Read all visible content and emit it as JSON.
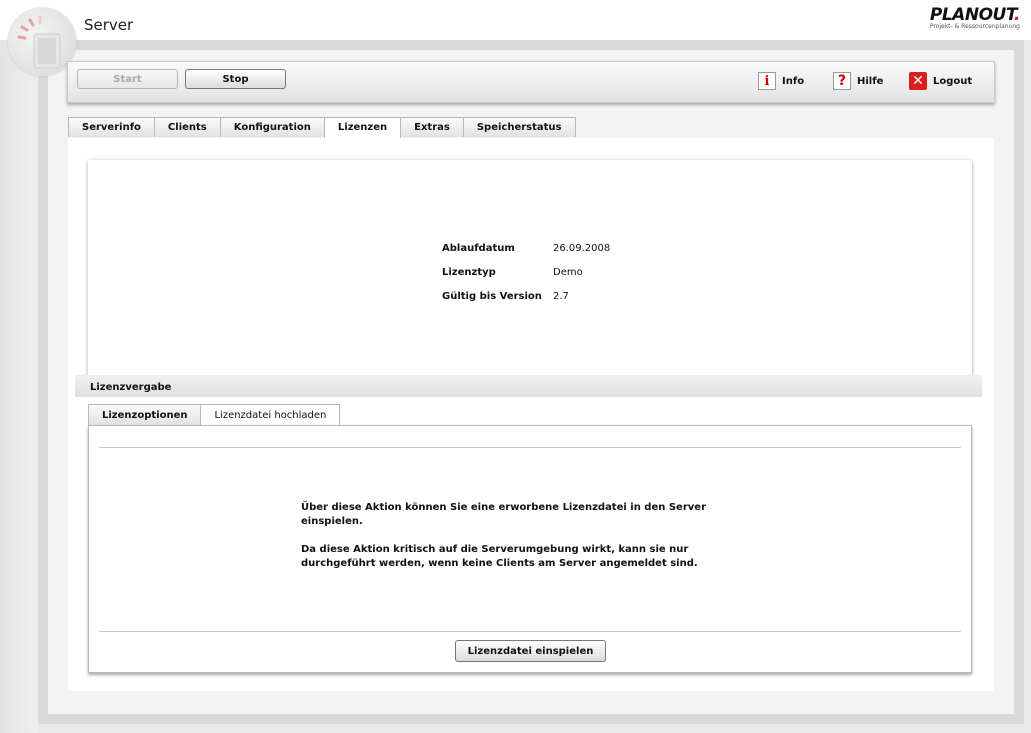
{
  "header": {
    "title": "Server",
    "brand_name": "PLANOUT",
    "brand_dot": ".",
    "brand_subtitle": "Projekt- & Ressourcenplanung"
  },
  "toolbar": {
    "start_label": "Start",
    "stop_label": "Stop",
    "info_label": "Info",
    "help_label": "Hilfe",
    "logout_label": "Logout"
  },
  "tabs": [
    {
      "label": "Serverinfo"
    },
    {
      "label": "Clients"
    },
    {
      "label": "Konfiguration"
    },
    {
      "label": "Lizenzen",
      "active": true
    },
    {
      "label": "Extras"
    },
    {
      "label": "Speicherstatus"
    }
  ],
  "license": {
    "expiry_label": "Ablaufdatum",
    "expiry_value": "26.09.2008",
    "type_label": "Lizenztyp",
    "type_value": "Demo",
    "version_label": "Gültig bis Version",
    "version_value": "2.7"
  },
  "section_title": "Lizenzvergabe",
  "subtabs": [
    {
      "label": "Lizenzoptionen"
    },
    {
      "label": "Lizenzdatei hochladen",
      "active": true
    }
  ],
  "upload": {
    "paragraph1": "Über diese Aktion können Sie eine erworbene Lizenzdatei in den Server einspielen.",
    "paragraph2": "Da diese Aktion kritisch auf die Serverumgebung wirkt, kann sie nur durchgeführt werden, wenn keine Clients am Server angemeldet sind.",
    "button_label": "Lizenzdatei einspielen"
  },
  "colors": {
    "accent": "#d81e1e",
    "background": "#e9e9e9"
  }
}
